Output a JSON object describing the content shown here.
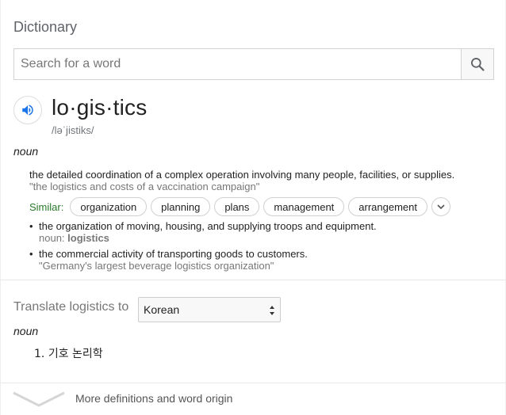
{
  "header": {
    "title": "Dictionary"
  },
  "search": {
    "placeholder": "Search for a word",
    "value": ""
  },
  "entry": {
    "word": "lo·gis·tics",
    "phonetic": "/ləˈjistiks/",
    "part_of_speech": "noun",
    "definitions": [
      {
        "text": "the detailed coordination of a complex operation involving many people, facilities, or supplies.",
        "example": "\"the logistics and costs of a vaccination campaign\"",
        "similar_label": "Similar:",
        "similar": [
          "organization",
          "planning",
          "plans",
          "management",
          "arrangement"
        ]
      }
    ],
    "sub_definitions": [
      {
        "bullet": "•",
        "text": "the organization of moving, housing, and supplying troops and equipment.",
        "noun_prefix": "noun:",
        "noun_word": "logistics"
      },
      {
        "bullet": "•",
        "text": "the commercial activity of transporting goods to customers.",
        "example": "\"Germany's largest beverage logistics organization\""
      }
    ]
  },
  "translate": {
    "label": "Translate logistics to",
    "language": "Korean",
    "part_of_speech": "noun",
    "results": [
      {
        "number": "1.",
        "text": "기호 논리학"
      }
    ]
  },
  "footer": {
    "more_label": "More definitions and word origin"
  },
  "colors": {
    "similar_green": "#2a7a2a",
    "speaker_blue": "#1a73e8"
  },
  "icons": {
    "search": "search-icon",
    "speaker": "speaker-icon",
    "expand": "chevron-down-icon",
    "more": "chevron-down-icon"
  }
}
